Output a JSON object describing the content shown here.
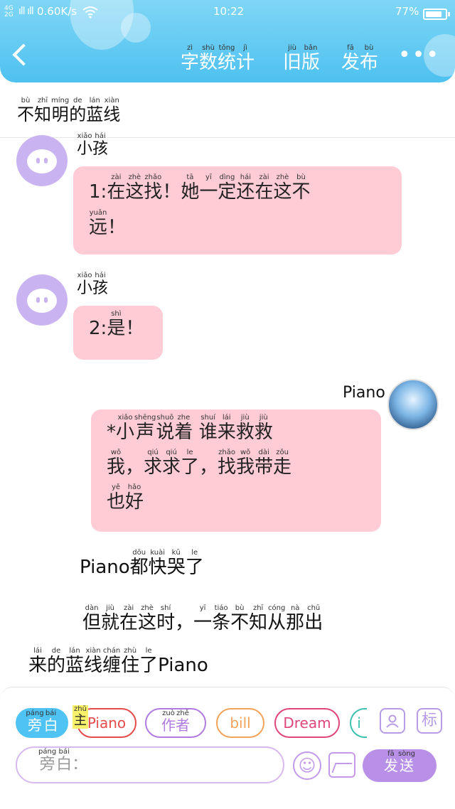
{
  "status_bar": {
    "network": "4G\n2G",
    "signal": "ıll ıll",
    "speed": "0.60K/s",
    "time": "10:22",
    "battery": "77%"
  },
  "header": {
    "word_count": {
      "chars": [
        "字",
        "数",
        "统",
        "计"
      ],
      "pinyin": [
        "zì",
        "shù",
        "tǒng",
        "jì"
      ]
    },
    "old_version": {
      "chars": [
        "旧",
        "版"
      ],
      "pinyin": [
        "jiù",
        "bǎn"
      ]
    },
    "publish": {
      "chars": [
        "发",
        "布"
      ],
      "pinyin": [
        "fā",
        "bù"
      ]
    },
    "more": "•••"
  },
  "title": {
    "chars": [
      "不",
      "知",
      "明",
      "的",
      "蓝",
      "线"
    ],
    "pinyin": [
      "bù",
      "zhī",
      "míng",
      "de",
      "lán",
      "xiàn"
    ]
  },
  "messages": [
    {
      "sender": {
        "chars": [
          "小",
          "孩"
        ],
        "pinyin": [
          "xiǎo",
          "hái"
        ]
      },
      "prefix": "1:",
      "lines": [
        [
          [
            "在",
            "zài"
          ],
          [
            "这",
            "zhè"
          ],
          [
            "找",
            "zhǎo"
          ],
          [
            "！",
            ""
          ],
          [
            "她",
            "tā"
          ],
          [
            "一",
            "yī"
          ],
          [
            "定",
            "dìng"
          ],
          [
            "还",
            "hái"
          ],
          [
            "在",
            "zài"
          ],
          [
            "这",
            "zhè"
          ],
          [
            "不",
            "bù"
          ]
        ],
        [
          [
            "远",
            "yuǎn"
          ],
          [
            "！",
            ""
          ]
        ]
      ]
    },
    {
      "sender": {
        "chars": [
          "小",
          "孩"
        ],
        "pinyin": [
          "xiǎo",
          "hái"
        ]
      },
      "prefix": "2:",
      "lines": [
        [
          [
            "是",
            "shì"
          ],
          [
            "！",
            ""
          ]
        ]
      ]
    },
    {
      "sender_name": "Piano",
      "prefix": "*",
      "lines": [
        [
          [
            "小",
            "xiǎo"
          ],
          [
            "声",
            "shēng"
          ],
          [
            "说",
            "shuō"
          ],
          [
            "着",
            "zhe"
          ],
          [
            " ",
            ""
          ],
          [
            "谁",
            "shuí"
          ],
          [
            "来",
            "lái"
          ],
          [
            "救",
            "jiù"
          ],
          [
            "救",
            "jiù"
          ]
        ],
        [
          [
            "我",
            "wǒ"
          ],
          [
            "，",
            ""
          ],
          [
            "求",
            "qiú"
          ],
          [
            "求",
            "qiú"
          ],
          [
            "了",
            "le"
          ],
          [
            "，",
            ""
          ],
          [
            "找",
            "zhǎo"
          ],
          [
            "我",
            "wǒ"
          ],
          [
            "带",
            "dài"
          ],
          [
            "走",
            "zǒu"
          ]
        ],
        [
          [
            "也",
            "yě"
          ],
          [
            "好",
            "hǎo"
          ]
        ]
      ]
    }
  ],
  "narration_1": {
    "prefix": "Piano",
    "lines": [
      [
        [
          "都",
          "dōu"
        ],
        [
          "快",
          "kuài"
        ],
        [
          "哭",
          "kū"
        ],
        [
          "了",
          "le"
        ]
      ]
    ]
  },
  "narration_2": {
    "lines": [
      [
        [
          "但",
          "dàn"
        ],
        [
          "就",
          "jiù"
        ],
        [
          "在",
          "zài"
        ],
        [
          "这",
          "zhè"
        ],
        [
          "时",
          "shí"
        ],
        [
          "，",
          ""
        ],
        [
          "一",
          "yī"
        ],
        [
          "条",
          "tiáo"
        ],
        [
          "不",
          "bù"
        ],
        [
          "知",
          "zhī"
        ],
        [
          "从",
          "cóng"
        ],
        [
          "那",
          "nà"
        ],
        [
          "出",
          "chū"
        ]
      ],
      [
        [
          "来",
          "lái"
        ],
        [
          "的",
          "de"
        ],
        [
          "蓝",
          "lán"
        ],
        [
          "线",
          "xiàn"
        ],
        [
          "缠",
          "chán"
        ],
        [
          "住",
          "zhù"
        ],
        [
          "了",
          "le"
        ]
      ]
    ],
    "suffix": "Piano"
  },
  "toolbar": {
    "narrator": {
      "chars": [
        "旁",
        "白"
      ],
      "pinyin": [
        "páng",
        "bái"
      ]
    },
    "main_tag": {
      "chars": [
        "主"
      ],
      "pinyin": [
        "zhǔ"
      ]
    },
    "characters": [
      {
        "label": "Piano",
        "color": "#e64b4b"
      },
      {
        "chars": [
          "作",
          "者"
        ],
        "pinyin": [
          "zuò",
          "zhě"
        ],
        "color": "#b07be0"
      },
      {
        "label": "bill",
        "color": "#f2a35a"
      },
      {
        "label": "Dream",
        "color": "#e0457b"
      },
      {
        "label": "i",
        "color": "#3cc0b0"
      }
    ],
    "profile_icon": "person-icon",
    "tag_label": "标",
    "input_placeholder": {
      "chars": [
        "旁",
        "白"
      ],
      "pinyin": [
        "páng",
        "bái"
      ],
      "colon": "："
    },
    "emoji": "☺",
    "send": {
      "chars": [
        "发",
        "送"
      ],
      "pinyin": [
        "fā",
        "sòng"
      ]
    }
  }
}
